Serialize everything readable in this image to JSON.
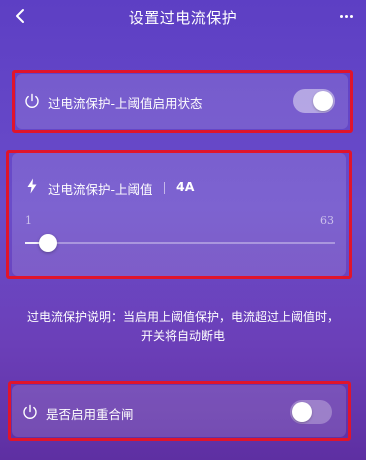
{
  "header": {
    "title": "设置过电流保护",
    "back_icon": "chevron-left-icon",
    "more_icon": "more-horizontal-icon"
  },
  "upper_threshold_enable": {
    "icon": "power-icon",
    "label": "过电流保护-上阈值启用状态",
    "enabled": true
  },
  "upper_threshold_value": {
    "icon": "lightning-bolt-icon",
    "label": "过电流保护-上阈值",
    "value": "4A",
    "slider": {
      "min_label": "1",
      "max_label": "63",
      "min": 1,
      "max": 63,
      "current": 4
    }
  },
  "description": {
    "line1": "过电流保护说明：当启用上阈值保护，电流超过上阈值时，",
    "line2": "开关将自动断电"
  },
  "auto_reclose": {
    "icon": "power-icon",
    "label": "是否启用重合闸",
    "enabled": false
  },
  "colors": {
    "background_top": "#5d3fc4",
    "background_bottom": "#5e2fa2",
    "highlight_border": "#e0142c",
    "card": "rgba(255,255,255,0.13)"
  }
}
